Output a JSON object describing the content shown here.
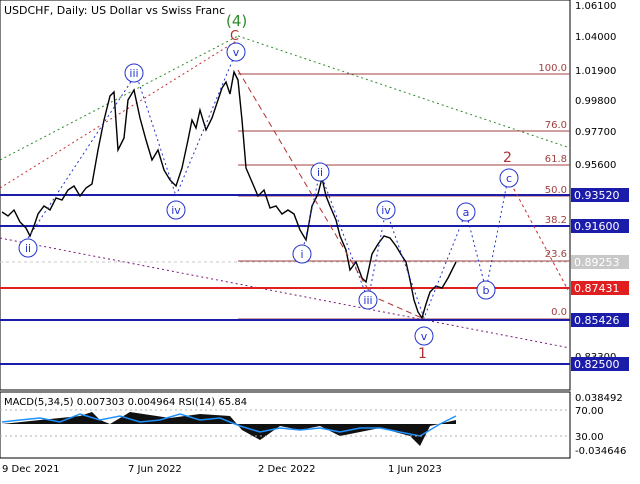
{
  "header": {
    "symbol_line": "USDCHF, Daily:  US Dollar vs Swiss Franc"
  },
  "price_axis": {
    "ticks": [
      "1.06100",
      "1.04000",
      "1.01900",
      "0.99800",
      "0.97700",
      "0.95600",
      "0.93520",
      "0.91600",
      "0.89253",
      "0.87431",
      "0.85426",
      "0.83300",
      "0.82500"
    ],
    "ticks_plain": [
      "1.06100",
      "1.04000",
      "1.01900",
      "0.99800",
      "0.97700",
      "0.95600",
      "0.83300"
    ],
    "boxed_levels": [
      {
        "label": "0.93520",
        "color": "#1c1caa"
      },
      {
        "label": "0.91600",
        "color": "#1c1caa"
      },
      {
        "label": "0.89253",
        "color": "#c8c8c8"
      },
      {
        "label": "0.87431",
        "color": "#e02020"
      },
      {
        "label": "0.85426",
        "color": "#1c1caa"
      },
      {
        "label": "0.82500",
        "color": "#1c1caa"
      }
    ]
  },
  "fibonacci": {
    "levels": [
      "100.0",
      "76.0",
      "61.8",
      "50.0",
      "38.2",
      "23.6",
      "0.0"
    ]
  },
  "wave_labels": {
    "major_4": "(4)",
    "major_C": "C",
    "major_2": "2",
    "major_1": "1",
    "minor": [
      "ii",
      "iii",
      "iv",
      "v",
      "i",
      "ii",
      "iii",
      "iv",
      "v",
      "a",
      "b",
      "c"
    ]
  },
  "indicator": {
    "label": "MACD(5,34,5) 0.007303 0.004964 RSI(14) 65.84",
    "axis_ticks": [
      "0.038492",
      "70.00",
      "30.00",
      "-0.034646"
    ]
  },
  "time_axis": {
    "labels": [
      "9 Dec 2021",
      "7 Jun 2022",
      "2 Dec 2022",
      "1 Jun 2023"
    ]
  },
  "colors": {
    "support_resistance": "#1c1caa",
    "key_level": "#e02020",
    "fib_line": "#a04040",
    "wave_major": "#b03030",
    "wave_4": "#2e8b2e",
    "wave_minor": "#2233cc",
    "macd_line": "#1e90ff"
  }
}
